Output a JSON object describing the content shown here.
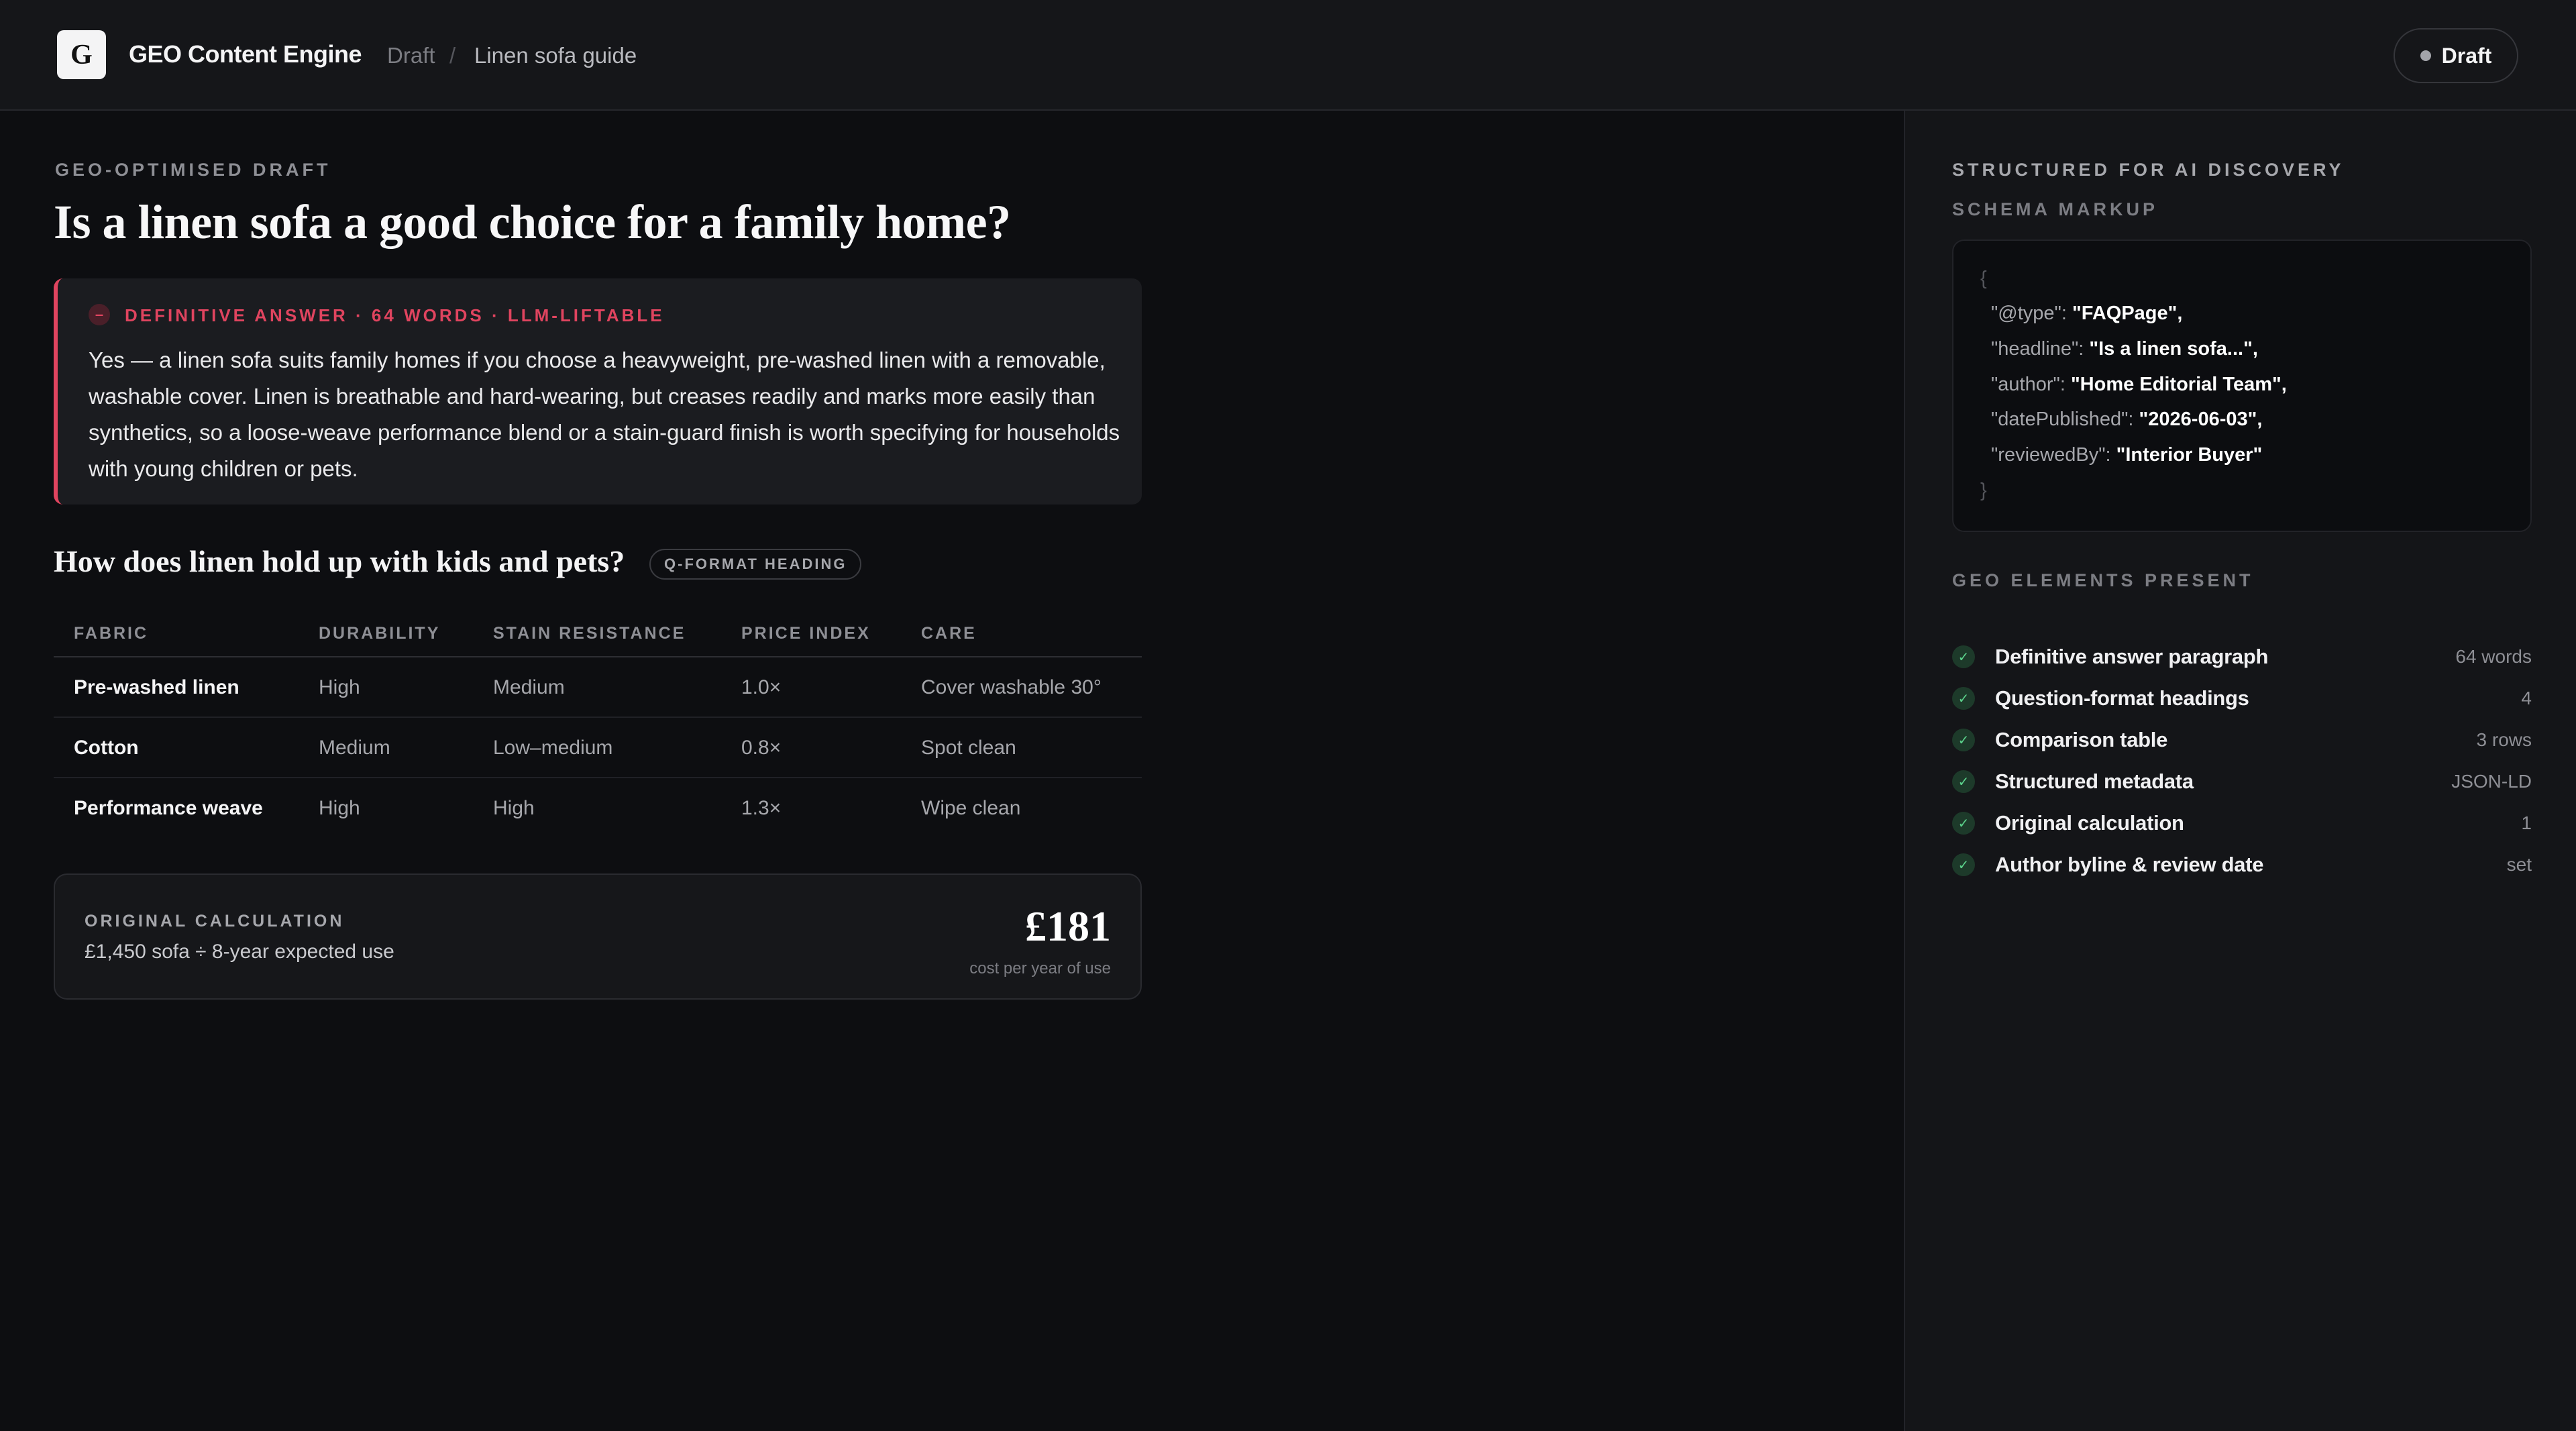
{
  "header": {
    "logo_letter": "G",
    "app_title": "GEO Content Engine",
    "breadcrumb": [
      "Draft",
      "/",
      "Linen sofa guide"
    ],
    "status": "Draft"
  },
  "main": {
    "label": "GEO-OPTIMISED DRAFT",
    "title": "Is a linen sofa a good choice for a family home?",
    "answer": {
      "icon": "–",
      "tag": "DEFINITIVE ANSWER · 64 WORDS · LLM-LIFTABLE",
      "text": "Yes — a linen sofa suits family homes if you choose a heavyweight, pre-washed linen with a removable, washable cover. Linen is breathable and hard-wearing, but creases readily and marks more easily than synthetics, so a loose-weave performance blend or a stain-guard finish is worth specifying for households with young children or pets."
    },
    "subheading": "How does linen hold up with kids and pets?",
    "subheading_badge": "Q-FORMAT HEADING",
    "table": {
      "headers": [
        "FABRIC",
        "DURABILITY",
        "STAIN RESISTANCE",
        "PRICE INDEX",
        "CARE"
      ],
      "rows": [
        [
          "Pre-washed linen",
          "High",
          "Medium",
          "1.0×",
          "Cover washable 30°"
        ],
        [
          "Cotton",
          "Medium",
          "Low–medium",
          "0.8×",
          "Spot clean"
        ],
        [
          "Performance weave",
          "High",
          "High",
          "1.3×",
          "Wipe clean"
        ]
      ]
    },
    "calculation": {
      "label": "ORIGINAL CALCULATION",
      "formula": "£1,450 sofa ÷ 8-year expected use",
      "value": "£181",
      "caption": "cost per year of use"
    }
  },
  "sidebar": {
    "label": "STRUCTURED FOR AI DISCOVERY",
    "schema_label": "SCHEMA MARKUP",
    "schema": {
      "open": "{",
      "close": "}",
      "lines": [
        {
          "key": "\"@type\": ",
          "value": "\"FAQPage\","
        },
        {
          "key": "\"headline\": ",
          "value": "\"Is a linen sofa...\","
        },
        {
          "key": "\"author\": ",
          "value": "\"Home Editorial Team\","
        },
        {
          "key": "\"datePublished\": ",
          "value": "\"2026-06-03\","
        },
        {
          "key": "\"reviewedBy\": ",
          "value": "\"Interior Buyer\""
        }
      ]
    },
    "elements_label": "GEO ELEMENTS PRESENT",
    "elements": [
      {
        "name": "Definitive answer paragraph",
        "meta": "64 words"
      },
      {
        "name": "Question-format headings",
        "meta": "4"
      },
      {
        "name": "Comparison table",
        "meta": "3 rows"
      },
      {
        "name": "Structured metadata",
        "meta": "JSON-LD"
      },
      {
        "name": "Original calculation",
        "meta": "1"
      },
      {
        "name": "Author byline & review date",
        "meta": "set"
      }
    ],
    "check_glyph": "✓"
  },
  "colors": {
    "accent_red": "#e0445f",
    "check_green": "#5bd18b",
    "background": "#0d0e11"
  }
}
